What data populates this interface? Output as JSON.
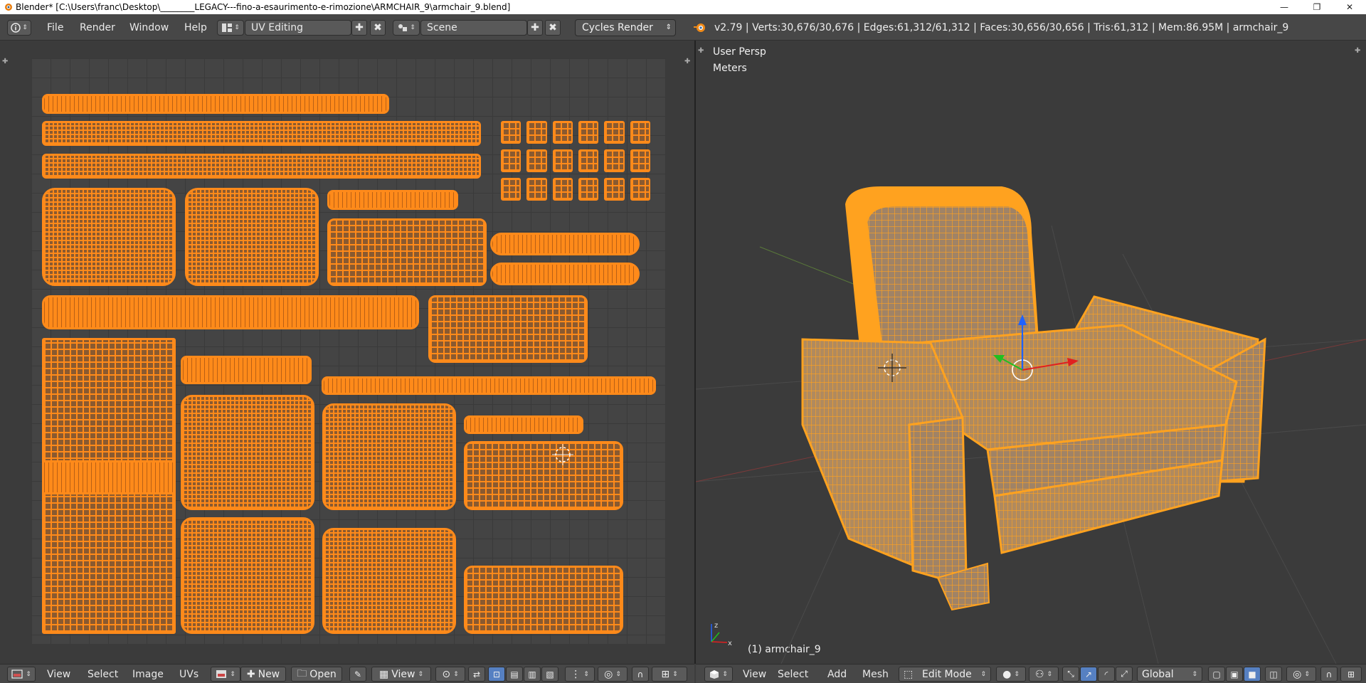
{
  "window": {
    "title": "Blender* [C:\\Users\\franc\\Desktop\\________LEGACY---fino-a-esaurimento-e-rimozione\\ARMCHAIR_9\\armchair_9.blend]",
    "controls": {
      "minimize": "—",
      "maximize": "❐",
      "close": "✕"
    }
  },
  "topbar": {
    "menus": [
      "File",
      "Render",
      "Window",
      "Help"
    ],
    "screen_layout": "UV Editing",
    "scene": "Scene",
    "render_engine": "Cycles Render",
    "stats": "v2.79 | Verts:30,676/30,676 | Edges:61,312/61,312 | Faces:30,656/30,656 | Tris:61,312 | Mem:86.95M | armchair_9"
  },
  "viewport": {
    "view_name": "User Persp",
    "units": "Meters",
    "object_label": "(1) armchair_9"
  },
  "uv_header": {
    "menus": [
      "View",
      "Select",
      "Image",
      "UVs"
    ],
    "new_label": "New",
    "open_label": "Open",
    "view_label": "View"
  },
  "view3d_header": {
    "menus": [
      "View",
      "Select",
      "Add",
      "Mesh"
    ],
    "mode": "Edit Mode",
    "orientation": "Global"
  },
  "colors": {
    "accent": "#ff8a1a",
    "header_bg": "#474747",
    "editor_bg": "#3b3b3b",
    "active_button": "#5680c2"
  }
}
